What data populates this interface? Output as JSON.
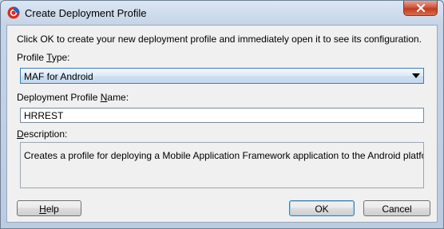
{
  "window": {
    "title": "Create Deployment Profile"
  },
  "dialog": {
    "instruction": "Click OK to create your new deployment profile and immediately open it to see its configuration.",
    "profile_type": {
      "label_pre": "Profile ",
      "label_mnemonic": "T",
      "label_post": "ype:",
      "selected": "MAF for Android"
    },
    "profile_name": {
      "label_pre": "Deployment Profile ",
      "label_mnemonic": "N",
      "label_post": "ame:",
      "value": "HRREST"
    },
    "description": {
      "label_pre": "",
      "label_mnemonic": "D",
      "label_post": "escription:",
      "text": "Creates a profile for deploying a Mobile Application Framework application to the Android platform."
    }
  },
  "buttons": {
    "help_pre": "",
    "help_mnemonic": "H",
    "help_post": "elp",
    "ok": "OK",
    "cancel": "Cancel"
  },
  "icons": {
    "app": "oracle-jdeveloper-icon",
    "close": "close-icon",
    "dropdown": "chevron-down-icon"
  },
  "colors": {
    "close_button": "#c23b1f",
    "focus_border": "#3c7fb1"
  }
}
